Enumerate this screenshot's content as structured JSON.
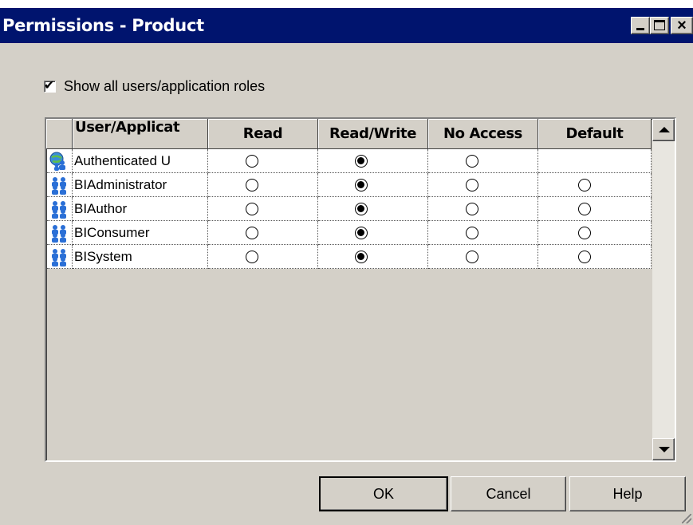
{
  "window": {
    "title": "Permissions - Product",
    "controls": {
      "minimize_icon": "minimize-icon",
      "maximize_icon": "maximize-icon",
      "close_glyph": "×"
    }
  },
  "show_all": {
    "label": "Show all users/application roles",
    "checked": true,
    "check_glyph": "✔"
  },
  "grid": {
    "headers": {
      "user": "User/Applicat",
      "read": "Read",
      "read_write": "Read/Write",
      "no_access": "No Access",
      "default": "Default"
    },
    "rows": [
      {
        "icon": "globe-users-icon",
        "name": "Authenticated U",
        "selection": "read_write",
        "has_default": false
      },
      {
        "icon": "users-icon",
        "name": "BIAdministrator",
        "selection": "read_write",
        "has_default": true
      },
      {
        "icon": "users-icon",
        "name": "BIAuthor",
        "selection": "read_write",
        "has_default": true
      },
      {
        "icon": "users-icon",
        "name": "BIConsumer",
        "selection": "read_write",
        "has_default": true
      },
      {
        "icon": "users-icon",
        "name": "BISystem",
        "selection": "read_write",
        "has_default": true
      }
    ]
  },
  "buttons": {
    "ok": "OK",
    "cancel": "Cancel",
    "help": "Help"
  },
  "colors": {
    "title_bar": "#00146e",
    "dialog_bg": "#d4d0c8",
    "icon_blue": "#2a6fd6"
  }
}
